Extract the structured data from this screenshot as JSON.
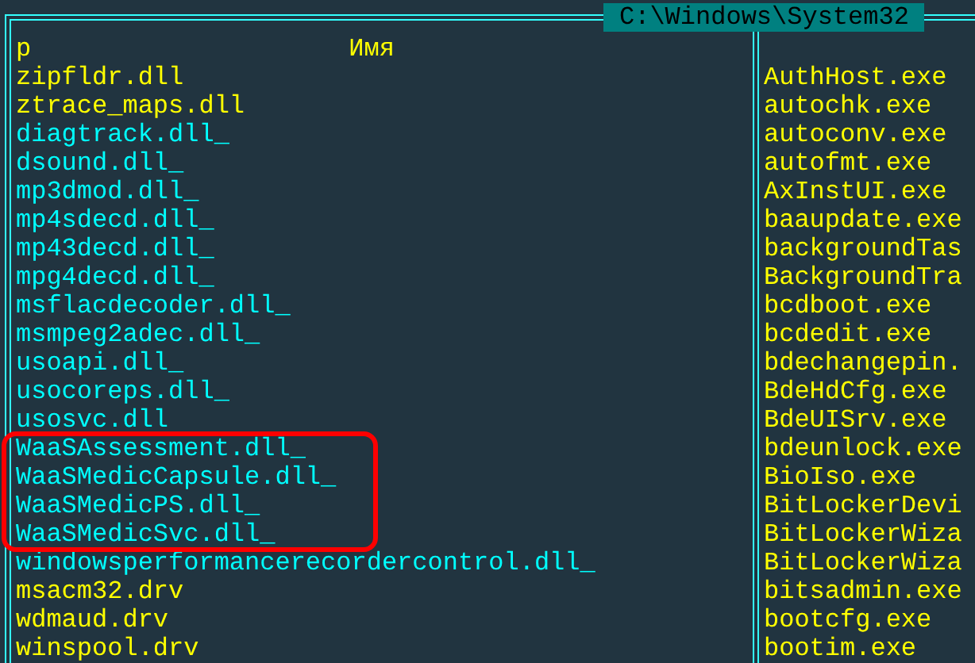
{
  "panel": {
    "path": "C:\\Windows\\System32",
    "header": {
      "sort_mark": "p",
      "column_title": "Имя"
    },
    "left_files": [
      {
        "name": "zipfldr.dll",
        "color": "#ffff00",
        "highlighted": false
      },
      {
        "name": "ztrace_maps.dll",
        "color": "#ffff00",
        "highlighted": false
      },
      {
        "name": "diagtrack.dll_",
        "color": "#00ffff",
        "highlighted": false
      },
      {
        "name": "dsound.dll_",
        "color": "#00ffff",
        "highlighted": false
      },
      {
        "name": "mp3dmod.dll_",
        "color": "#00ffff",
        "highlighted": false
      },
      {
        "name": "mp4sdecd.dll_",
        "color": "#00ffff",
        "highlighted": false
      },
      {
        "name": "mp43decd.dll_",
        "color": "#00ffff",
        "highlighted": false
      },
      {
        "name": "mpg4decd.dll_",
        "color": "#00ffff",
        "highlighted": false
      },
      {
        "name": "msflacdecoder.dll_",
        "color": "#00ffff",
        "highlighted": false
      },
      {
        "name": "msmpeg2adec.dll_",
        "color": "#00ffff",
        "highlighted": false
      },
      {
        "name": "usoapi.dll_",
        "color": "#00ffff",
        "highlighted": false
      },
      {
        "name": "usocoreps.dll_",
        "color": "#00ffff",
        "highlighted": false
      },
      {
        "name": "usosvc.dll",
        "color": "#00ffff",
        "highlighted": false
      },
      {
        "name": "WaaSAssessment.dll_",
        "color": "#00ffff",
        "highlighted": true
      },
      {
        "name": "WaaSMedicCapsule.dll_",
        "color": "#00ffff",
        "highlighted": true
      },
      {
        "name": "WaaSMedicPS.dll_",
        "color": "#00ffff",
        "highlighted": true
      },
      {
        "name": "WaaSMedicSvc.dll_",
        "color": "#00ffff",
        "highlighted": true
      },
      {
        "name": "windowsperformancerecordercontrol.dll_",
        "color": "#00ffff",
        "highlighted": false
      },
      {
        "name": "msacm32.drv",
        "color": "#ffff00",
        "highlighted": false
      },
      {
        "name": "wdmaud.drv",
        "color": "#ffff00",
        "highlighted": false
      },
      {
        "name": "winspool.drv",
        "color": "#ffff00",
        "highlighted": false
      }
    ],
    "right_files": [
      {
        "name": "AuthHost.exe",
        "color": "#ffff00"
      },
      {
        "name": "autochk.exe",
        "color": "#ffff00"
      },
      {
        "name": "autoconv.exe",
        "color": "#ffff00"
      },
      {
        "name": "autofmt.exe",
        "color": "#ffff00"
      },
      {
        "name": "AxInstUI.exe",
        "color": "#ffff00"
      },
      {
        "name": "baaupdate.exe",
        "color": "#ffff00"
      },
      {
        "name": "backgroundTas",
        "color": "#ffff00"
      },
      {
        "name": "BackgroundTra",
        "color": "#ffff00"
      },
      {
        "name": "bcdboot.exe",
        "color": "#ffff00"
      },
      {
        "name": "bcdedit.exe",
        "color": "#ffff00"
      },
      {
        "name": "bdechangepin.",
        "color": "#ffff00"
      },
      {
        "name": "BdeHdCfg.exe",
        "color": "#ffff00"
      },
      {
        "name": "BdeUISrv.exe",
        "color": "#ffff00"
      },
      {
        "name": "bdeunlock.exe",
        "color": "#ffff00"
      },
      {
        "name": "BioIso.exe",
        "color": "#ffff00"
      },
      {
        "name": "BitLockerDevi",
        "color": "#ffff00"
      },
      {
        "name": "BitLockerWiza",
        "color": "#ffff00"
      },
      {
        "name": "BitLockerWiza",
        "color": "#ffff00"
      },
      {
        "name": "bitsadmin.exe",
        "color": "#ffff00"
      },
      {
        "name": "bootcfg.exe",
        "color": "#ffff00"
      },
      {
        "name": "bootim.exe",
        "color": "#ffff00"
      }
    ]
  }
}
